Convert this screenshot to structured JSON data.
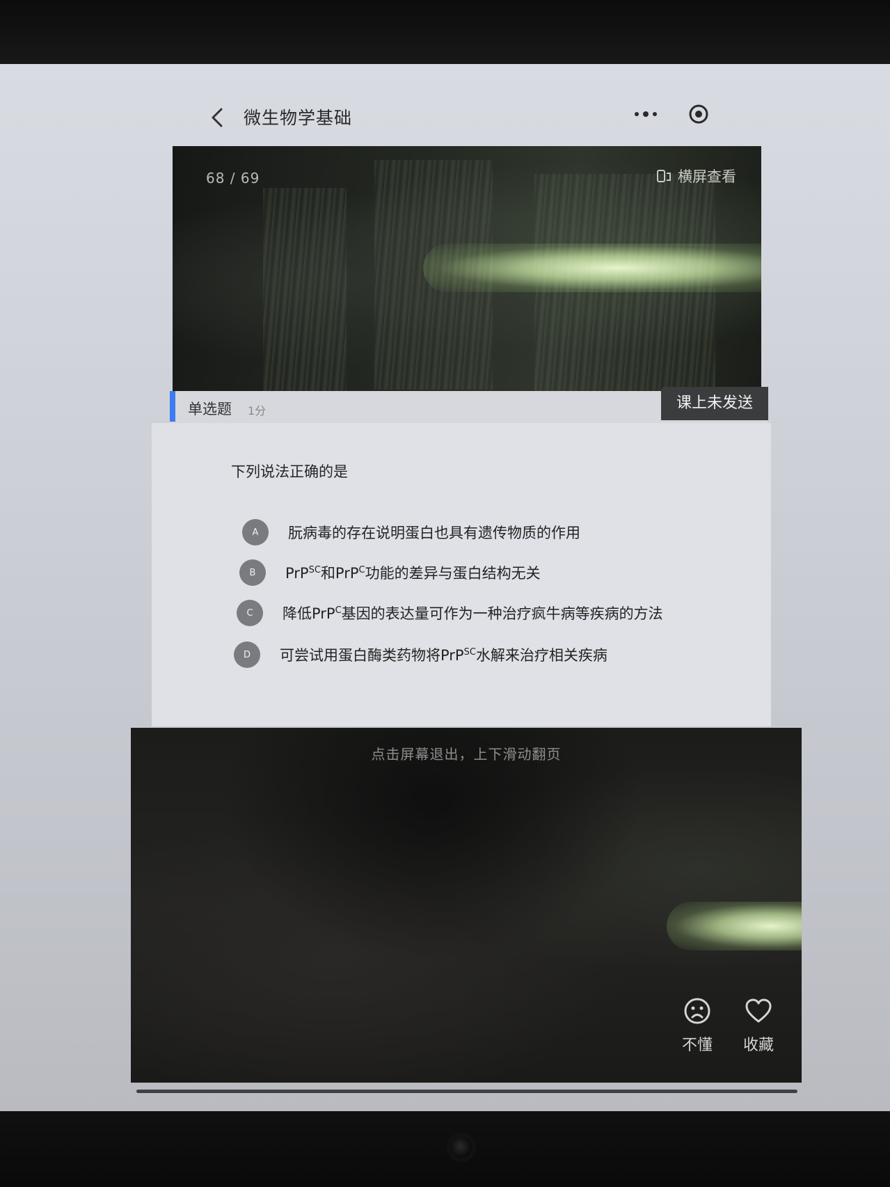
{
  "nav": {
    "title": "微生物学基础",
    "back_icon": "chevron-left-icon",
    "more_icon": "more-dots-icon",
    "target_icon": "target-icon"
  },
  "slide": {
    "page_counter": "68 / 69",
    "landscape_label": "横屏查看",
    "landscape_icon": "rotate-screen-icon"
  },
  "question": {
    "type_label": "单选题",
    "score_label": "1分",
    "status_badge": "课上未发送",
    "stem": "下列说法正确的是",
    "options": [
      {
        "letter": "A",
        "parts": [
          "朊病毒的存在说明蛋白也具有遗传物质的作用"
        ]
      },
      {
        "letter": "B",
        "parts": [
          "PrP",
          "SC",
          "和PrP",
          "C",
          "功能的差异与蛋白结构无关"
        ]
      },
      {
        "letter": "C",
        "parts": [
          "降低PrP",
          "C",
          "基因的表达量可作为一种治疗疯牛病等疾病的方法"
        ]
      },
      {
        "letter": "D",
        "parts": [
          "可尝试用蛋白酶类药物将PrP",
          "SC",
          "水解来治疗相关疾病"
        ]
      }
    ]
  },
  "footer": {
    "hint": "点击屏幕退出，上下滑动翻页",
    "dont_understand_label": "不懂",
    "dont_understand_icon": "sad-face-icon",
    "favorite_label": "收藏",
    "favorite_icon": "heart-icon"
  },
  "colors": {
    "accent": "#3d7bf0",
    "badge_bg": "#3a3c3e",
    "option_circle": "#7a7b7e"
  }
}
